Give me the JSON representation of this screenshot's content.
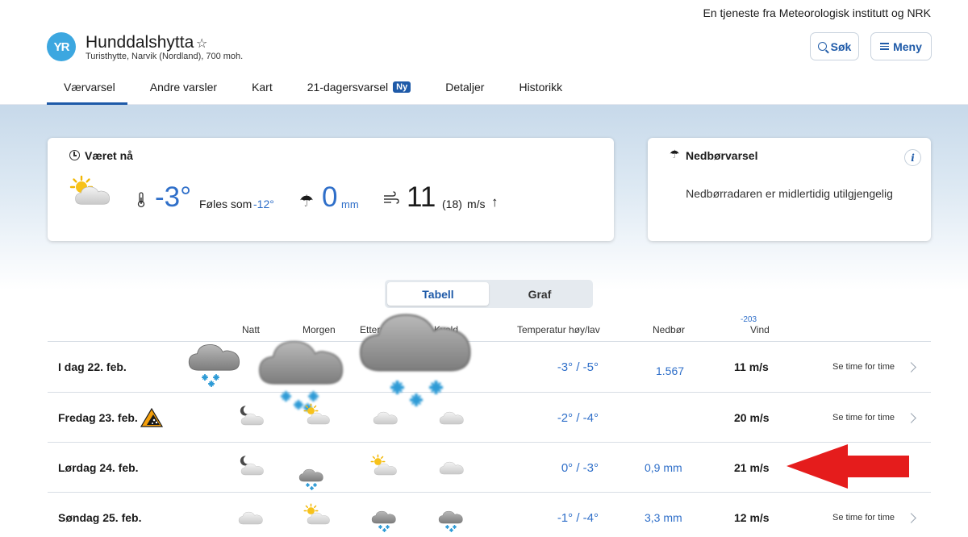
{
  "header": {
    "service_credit": "En tjeneste fra Meteorologisk institutt og NRK",
    "logo_text": "YR",
    "location_name": "Hunddalshytta",
    "star": "☆",
    "location_sub": "Turisthytte, Narvik (Nordland), 700 moh.",
    "search_label": "Søk",
    "menu_label": "Meny"
  },
  "tabs": [
    {
      "label": "Værvarsel",
      "active": true
    },
    {
      "label": "Andre varsler"
    },
    {
      "label": "Kart"
    },
    {
      "label": "21-dagersvarsel",
      "badge": "Ny"
    },
    {
      "label": "Detaljer"
    },
    {
      "label": "Historikk"
    }
  ],
  "now": {
    "title": "Været nå",
    "icon": "partly-cloudy-sun-icon",
    "temperature": "-3°",
    "feels_like_label": "Føles som",
    "feels_like_value": "-12°",
    "precipitation": "0",
    "precipitation_unit": "mm",
    "wind": "11",
    "gust": "(18)",
    "wind_unit": "m/s",
    "wind_arrow": "↑"
  },
  "precip_card": {
    "title": "Nedbørvarsel",
    "info": "i",
    "message": "Nedbørradaren er midlertidig utilgjengelig"
  },
  "view_toggle": {
    "table_label": "Tabell",
    "graph_label": "Graf",
    "selected": "Tabell"
  },
  "columns": {
    "night": "Natt",
    "morning": "Morgen",
    "afternoon": "Ettermiddag",
    "evening": "Kveld",
    "temperature": "Temperatur høy/lav",
    "precipitation": "Nedbør",
    "wind": "Vind",
    "wind_extra": "-203"
  },
  "forecast": [
    {
      "date": "I dag 22. feb.",
      "temp": "-3° / -5°",
      "precip": "1.567",
      "wind": "11 m/s",
      "link": "Se time for time"
    },
    {
      "date": "Fredag 23. feb.",
      "temp": "-2° / -4°",
      "precip": "",
      "wind": "20 m/s",
      "link": "Se time for time",
      "warning": "avalanche-warning-icon"
    },
    {
      "date": "Lørdag 24. feb.",
      "temp": "0° / -3°",
      "precip": "0,9 mm",
      "wind": "21 m/s",
      "link": ""
    },
    {
      "date": "Søndag 25. feb.",
      "temp": "-1° / -4°",
      "precip": "3,3 mm",
      "wind": "12 m/s",
      "link": "Se time for time"
    }
  ],
  "colors": {
    "brand": "#3ca7e0",
    "accent": "#1e5aa8",
    "temp_blue": "#2f6fc9",
    "annotation_arrow": "#e02020"
  }
}
